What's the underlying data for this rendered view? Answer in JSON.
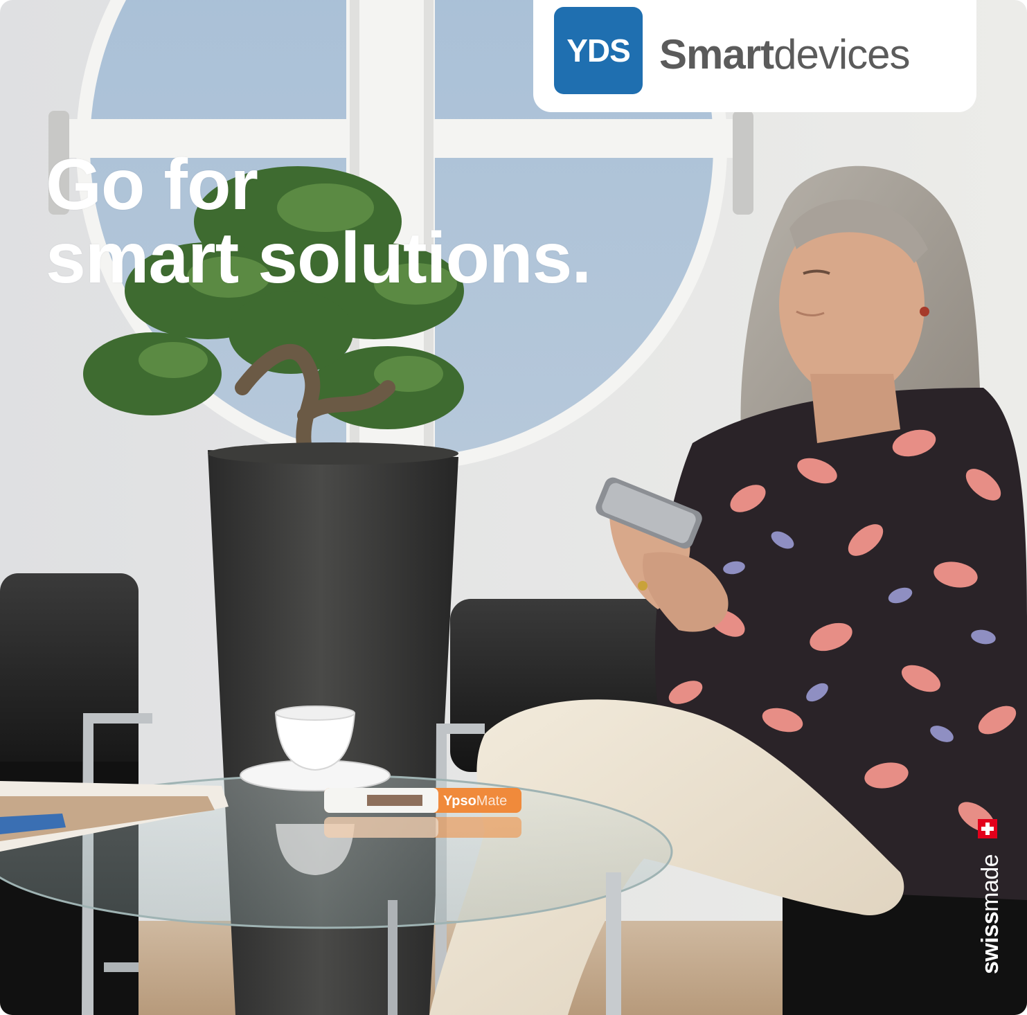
{
  "brand": {
    "mark": "YDS",
    "name_strong": "Smart",
    "name_light": "devices",
    "color_mark": "#1f6fb0"
  },
  "headline": {
    "line1": "Go for",
    "line2": "smart solutions."
  },
  "badge": {
    "strong": "swiss",
    "light": "made",
    "flag_icon": "swiss-cross-icon"
  },
  "pen": {
    "label_strong": "Ypso",
    "label_light": "Mate"
  }
}
